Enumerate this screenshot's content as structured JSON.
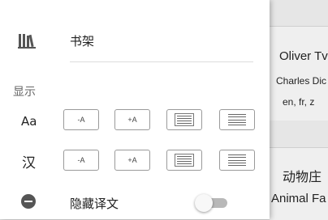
{
  "background": {
    "card1": {
      "title": "Oliver Tv",
      "author": "Charles Dic",
      "languages": "en, fr, z"
    },
    "card2": {
      "title_zh": "动物庄",
      "title_en": "Animal Fa"
    }
  },
  "drawer": {
    "bookshelf": {
      "label": "书架",
      "icon": "bookshelf-icon"
    },
    "display": {
      "section_label": "显示",
      "rows": [
        {
          "label": "Aa",
          "decrease": "-A",
          "increase": "+A"
        },
        {
          "label": "汉",
          "decrease": "-A",
          "increase": "+A"
        }
      ]
    },
    "hide_translation": {
      "label": "隐藏译文",
      "enabled": false,
      "icon": "minus-circle-icon"
    }
  },
  "colors": {
    "drawer_bg": "#ffffff",
    "overlay": "#d8d8d8",
    "icon": "#555555"
  }
}
